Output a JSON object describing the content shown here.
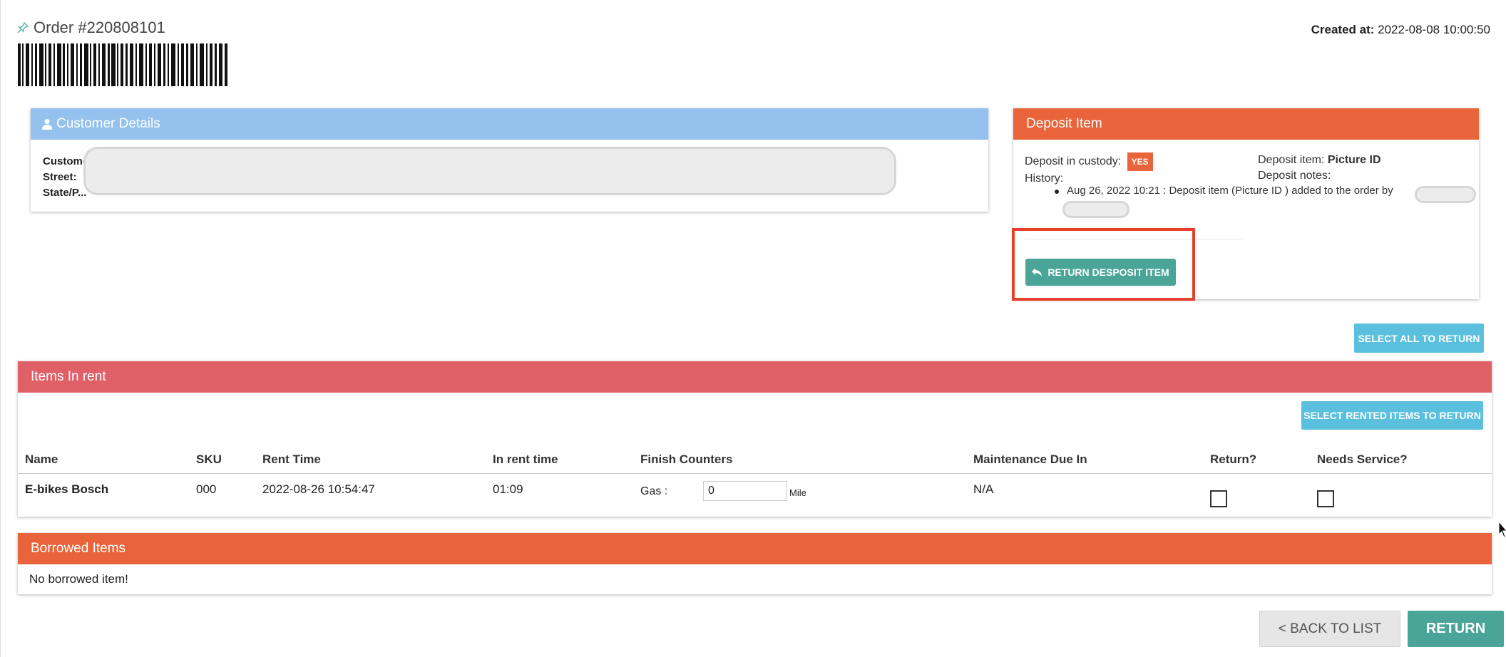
{
  "header": {
    "order_title": "Order #220808101",
    "created_label": "Created at:",
    "created_value": "2022-08-08 10:00:50"
  },
  "customer": {
    "title": "Customer Details",
    "labels": [
      "Customer",
      "Street:",
      "State/P..."
    ]
  },
  "deposit": {
    "title": "Deposit Item",
    "in_custody_label": "Deposit in custody:",
    "in_custody_value": "YES",
    "history_label": "History:",
    "item_label": "Deposit item:",
    "item_value": "Picture ID",
    "notes_label": "Deposit notes:",
    "history_entry": "Aug 26, 2022 10:21 : Deposit item (Picture ID ) added to the order by",
    "return_button": "RETURN DESPOSIT ITEM"
  },
  "select_all_button": "SELECT ALL TO RETURN",
  "items": {
    "title": "Items In rent",
    "select_rented_button": "SELECT RENTED ITEMS TO RETURN",
    "columns": [
      "Name",
      "SKU",
      "Rent Time",
      "In rent time",
      "Finish Counters",
      "Maintenance Due In",
      "Return?",
      "Needs Service?"
    ],
    "rows": [
      {
        "name": "E-bikes Bosch",
        "sku": "000",
        "rent_time": "2022-08-26 10:54:47",
        "in_rent_time": "01:09",
        "counter_label": "Gas :",
        "counter_value": "0",
        "counter_unit": "Mile",
        "maintenance_due": "N/A"
      }
    ]
  },
  "borrowed": {
    "title": "Borrowed Items",
    "empty_text": "No borrowed item!"
  },
  "footer": {
    "back_button": "< BACK TO LIST",
    "return_button": "RETURN"
  },
  "colors": {
    "customer_header": "#94c1ee",
    "deposit_header": "#e9643a",
    "items_header": "#e06068",
    "teal_button": "#4aa598",
    "cyan_button": "#5bc0de",
    "highlight": "#e6402c"
  }
}
